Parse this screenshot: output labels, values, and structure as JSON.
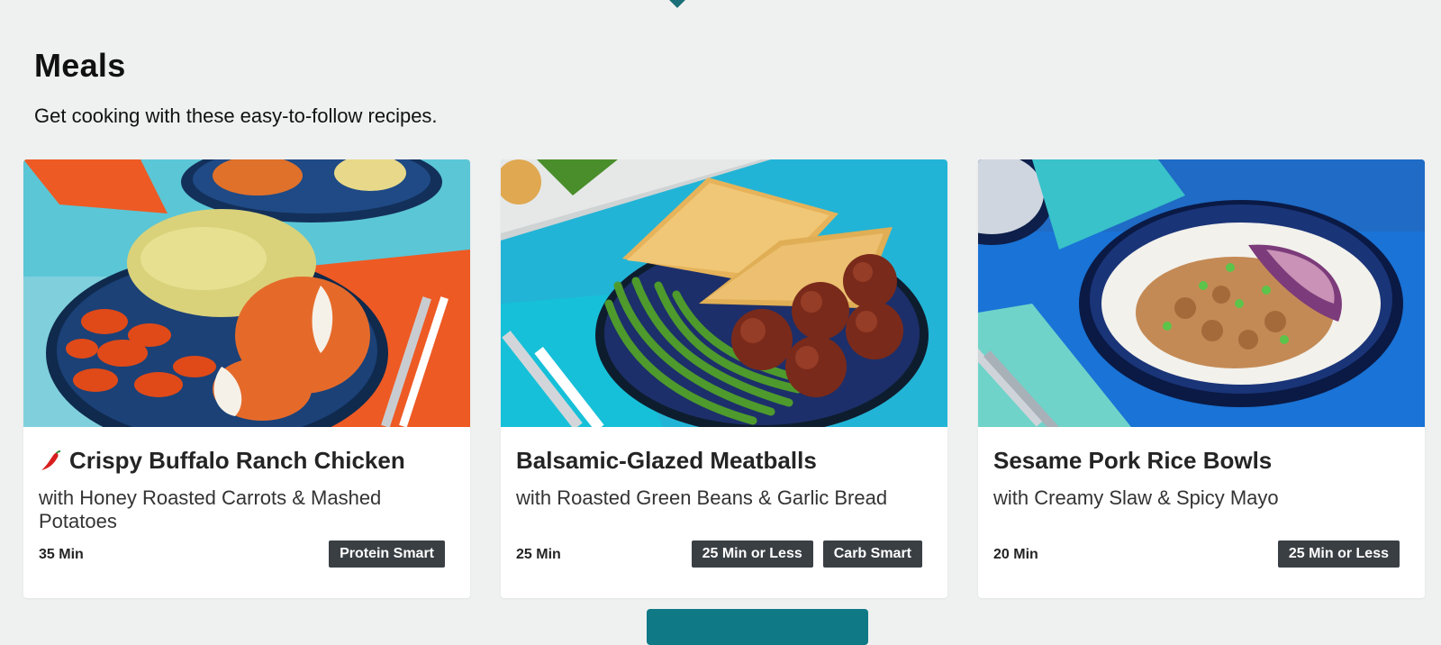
{
  "section": {
    "title": "Meals",
    "subtitle": "Get cooking with these easy-to-follow recipes."
  },
  "recipes": [
    {
      "title": "Crispy Buffalo Ranch Chicken",
      "subtitle": "with Honey Roasted Carrots & Mashed Potatoes",
      "time": "35 Min",
      "tags": [
        "Protein Smart"
      ],
      "spicy": true,
      "image": "buffalo-chicken-plate-photo"
    },
    {
      "title": "Balsamic-Glazed Meatballs",
      "subtitle": "with Roasted Green Beans & Garlic Bread",
      "time": "25 Min",
      "tags": [
        "25 Min or Less",
        "Carb Smart"
      ],
      "spicy": false,
      "image": "meatballs-plate-photo"
    },
    {
      "title": "Sesame Pork Rice Bowls",
      "subtitle": "with Creamy Slaw & Spicy Mayo",
      "time": "20 Min",
      "tags": [
        "25 Min or Less"
      ],
      "spicy": false,
      "image": "pork-rice-bowl-photo"
    }
  ],
  "icons": {
    "spicy": "chili-pepper-icon"
  },
  "colors": {
    "page_background": "#eff1f0",
    "tag_background": "#3a3f44",
    "accent_teal": "#0f7a86",
    "chili_red": "#d81e1e"
  }
}
